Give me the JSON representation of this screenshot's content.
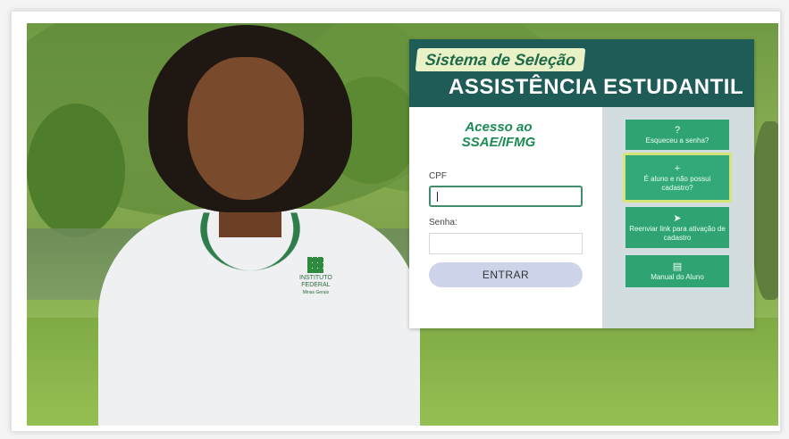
{
  "login": {
    "header_subtitle": "Sistema de Seleção",
    "header_title": "ASSISTÊNCIA ESTUDANTIL",
    "access_title_line1": "Acesso ao",
    "access_title_line2": "SSAE/IFMG",
    "cpf_label": "CPF",
    "cpf_value": "",
    "senha_label": "Senha:",
    "senha_value": "",
    "submit_label": "ENTRAR"
  },
  "side_actions": [
    {
      "label": "Esqueceu a senha?",
      "icon": "question-circle-icon",
      "glyph": "?"
    },
    {
      "label": "É aluno e não possui cadastro?",
      "icon": "add-user-icon",
      "glyph": "+"
    },
    {
      "label": "Reenviar link para ativação de cadastro",
      "icon": "send-icon",
      "glyph": "➤"
    },
    {
      "label": "Manual do Aluno",
      "icon": "manual-icon",
      "glyph": "▤"
    }
  ],
  "shirt_logo": {
    "line1": "INSTITUTO",
    "line2": "FEDERAL",
    "line3": "Minas Gerais"
  },
  "colors": {
    "header": "#1f5c57",
    "accent_green": "#2fa372",
    "title_green": "#1c8a53",
    "button_bg": "#cdd4ea"
  }
}
